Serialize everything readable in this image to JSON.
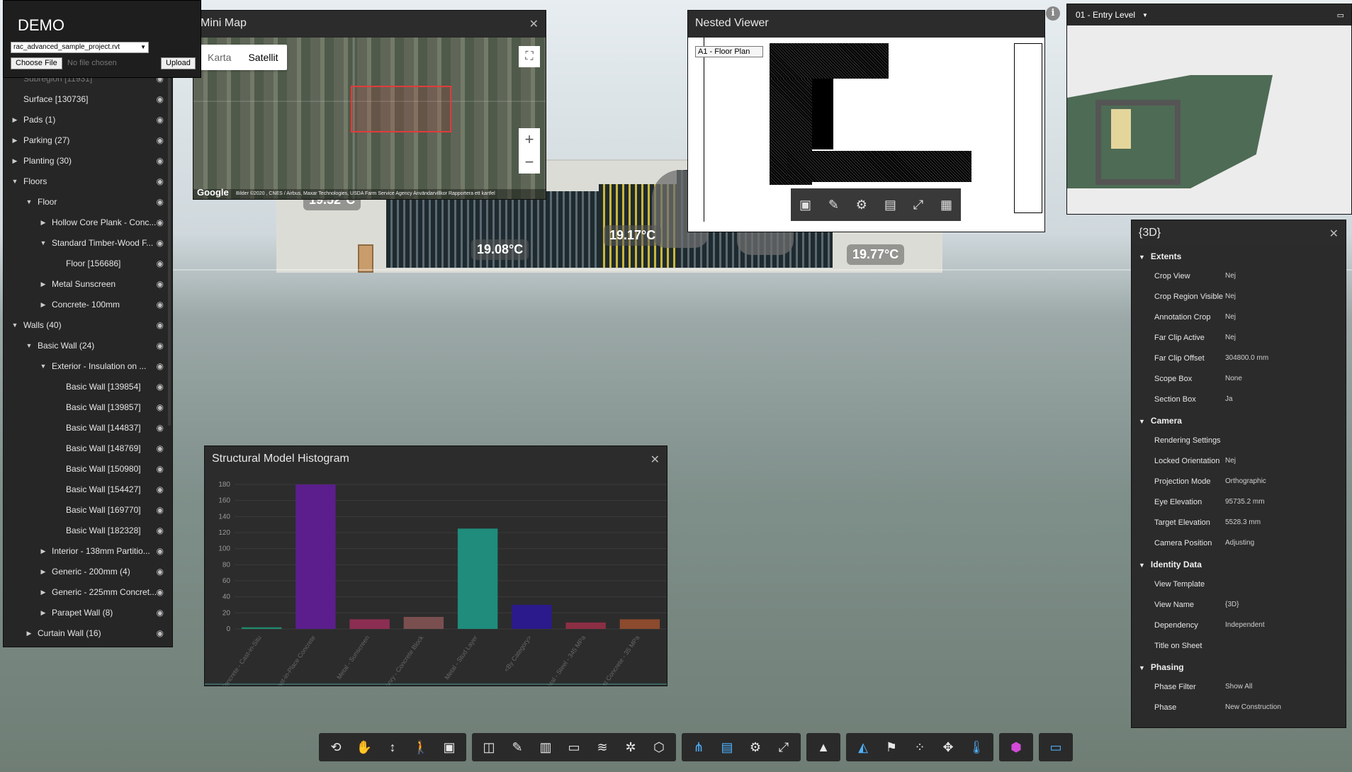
{
  "demo": {
    "title": "DEMO",
    "file_select": "rac_advanced_sample_project.rvt",
    "choose_file_label": "Choose File",
    "no_file_text": "No file chosen",
    "upload_label": "Upload"
  },
  "tree": {
    "items": [
      {
        "label": "Subregion [11931]",
        "indent": 0,
        "arrow": ""
      },
      {
        "label": "Surface [130736]",
        "indent": 0,
        "arrow": ""
      },
      {
        "label": "Pads (1)",
        "indent": 0,
        "arrow": "▶"
      },
      {
        "label": "Parking (27)",
        "indent": 0,
        "arrow": "▶"
      },
      {
        "label": "Planting (30)",
        "indent": 0,
        "arrow": "▶"
      },
      {
        "label": "Floors",
        "indent": 0,
        "arrow": "▼"
      },
      {
        "label": "Floor",
        "indent": 1,
        "arrow": "▼"
      },
      {
        "label": "Hollow Core Plank - Conc...",
        "indent": 2,
        "arrow": "▶"
      },
      {
        "label": "Standard Timber-Wood F...",
        "indent": 2,
        "arrow": "▼"
      },
      {
        "label": "Floor [156686]",
        "indent": 3,
        "arrow": ""
      },
      {
        "label": "Metal Sunscreen",
        "indent": 2,
        "arrow": "▶"
      },
      {
        "label": "Concrete- 100mm",
        "indent": 2,
        "arrow": "▶"
      },
      {
        "label": "Walls (40)",
        "indent": 0,
        "arrow": "▼"
      },
      {
        "label": "Basic Wall (24)",
        "indent": 1,
        "arrow": "▼"
      },
      {
        "label": "Exterior - Insulation on ...",
        "indent": 2,
        "arrow": "▼"
      },
      {
        "label": "Basic Wall [139854]",
        "indent": 3,
        "arrow": ""
      },
      {
        "label": "Basic Wall [139857]",
        "indent": 3,
        "arrow": ""
      },
      {
        "label": "Basic Wall [144837]",
        "indent": 3,
        "arrow": ""
      },
      {
        "label": "Basic Wall [148769]",
        "indent": 3,
        "arrow": ""
      },
      {
        "label": "Basic Wall [150980]",
        "indent": 3,
        "arrow": ""
      },
      {
        "label": "Basic Wall [154427]",
        "indent": 3,
        "arrow": ""
      },
      {
        "label": "Basic Wall [169770]",
        "indent": 3,
        "arrow": ""
      },
      {
        "label": "Basic Wall [182328]",
        "indent": 3,
        "arrow": ""
      },
      {
        "label": "Interior - 138mm Partitio...",
        "indent": 2,
        "arrow": "▶"
      },
      {
        "label": "Generic - 200mm (4)",
        "indent": 2,
        "arrow": "▶"
      },
      {
        "label": "Generic - 225mm Concret...",
        "indent": 2,
        "arrow": "▶"
      },
      {
        "label": "Parapet Wall (8)",
        "indent": 2,
        "arrow": "▶"
      },
      {
        "label": "Curtain Wall (16)",
        "indent": 1,
        "arrow": "▶"
      }
    ]
  },
  "scene": {
    "temps": [
      "19.52°C",
      "19.08°C",
      "19.17°C",
      "19.77°C"
    ]
  },
  "minimap": {
    "title": "Mini Map",
    "tab_map": "Karta",
    "tab_satellite": "Satellit",
    "google": "Google",
    "attribution": "Bilder ©2020 , CNES / Airbus, Maxar Technologies, USDA Farm Service Agency   Användarvillkor   Rapportera ett kartfel"
  },
  "nested": {
    "title": "Nested Viewer",
    "sheet_select": "A1 - Floor Plan"
  },
  "level_view": {
    "title": "01 - Entry Level"
  },
  "properties": {
    "title": "{3D}",
    "sections": [
      {
        "name": "Extents",
        "rows": [
          [
            "Crop View",
            "Nej"
          ],
          [
            "Crop Region Visible",
            "Nej"
          ],
          [
            "Annotation Crop",
            "Nej"
          ],
          [
            "Far Clip Active",
            "Nej"
          ],
          [
            "Far Clip Offset",
            "304800.0 mm"
          ],
          [
            "Scope Box",
            "None"
          ],
          [
            "Section Box",
            "Ja"
          ]
        ]
      },
      {
        "name": "Camera",
        "rows": [
          [
            "Rendering Settings",
            ""
          ],
          [
            "Locked Orientation",
            "Nej"
          ],
          [
            "Projection Mode",
            "Orthographic"
          ],
          [
            "Eye Elevation",
            "95735.2 mm"
          ],
          [
            "Target Elevation",
            "5528.3 mm"
          ],
          [
            "Camera Position",
            "Adjusting"
          ]
        ]
      },
      {
        "name": "Identity Data",
        "rows": [
          [
            "View Template",
            ""
          ],
          [
            "View Name",
            "{3D}"
          ],
          [
            "Dependency",
            "Independent"
          ],
          [
            "Title on Sheet",
            ""
          ]
        ]
      },
      {
        "name": "Phasing",
        "rows": [
          [
            "Phase Filter",
            "Show All"
          ],
          [
            "Phase",
            "New Construction"
          ]
        ]
      }
    ]
  },
  "histogram": {
    "title": "Structural Model Histogram"
  },
  "chart_data": {
    "type": "bar",
    "title": "Structural Model Histogram",
    "categories": [
      "Concrete - Cast-in-Situ",
      "Concrete - Cast-in-Place Concrete",
      "Metal - Sunscreen",
      "Masonry - Concrete Block",
      "Metal - Stud Layer",
      "<By Category>",
      "Metal - Steel - 345 MPa",
      "Precast Concrete - 35 MPa"
    ],
    "values": [
      2,
      180,
      12,
      15,
      125,
      30,
      8,
      12
    ],
    "colors": [
      "#1f8c6e",
      "#5b1e8c",
      "#8c2e52",
      "#7a4f4f",
      "#1f8c7c",
      "#2b1a8c",
      "#8c2e44",
      "#8c4a2e"
    ],
    "ylim": [
      0,
      180
    ],
    "yticks": [
      0,
      20,
      40,
      60,
      80,
      100,
      120,
      140,
      160,
      180
    ],
    "grid": true
  },
  "toolbar": {
    "groups": [
      [
        "orbit-icon",
        "pan-icon",
        "zoom-icon",
        "first-person-icon",
        "camera-icon"
      ],
      [
        "section-box-icon",
        "measure-icon",
        "explode-icon",
        "folder-icon",
        "layers-icon",
        "model-browser-icon",
        "cube-icon"
      ],
      [
        "structure-icon",
        "properties-icon",
        "settings-icon",
        "fullscreen-icon"
      ],
      [
        "image-icon"
      ],
      [
        "map-icon",
        "flag-icon",
        "grid-icon",
        "move-icon",
        "thermometer-icon"
      ],
      [
        "gem-icon"
      ],
      [
        "window-icon"
      ]
    ]
  }
}
